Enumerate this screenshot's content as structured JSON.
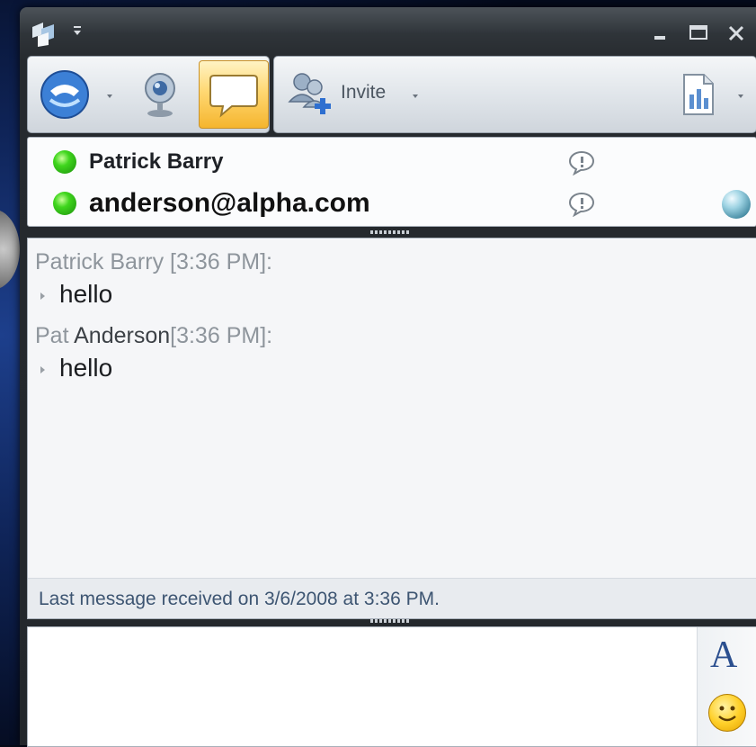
{
  "window": {
    "app_icon": "communicator-icon",
    "controls": [
      "minimize-icon",
      "maximize-icon",
      "close-icon"
    ]
  },
  "toolbar": {
    "call_icon": "phone-call-icon",
    "video_icon": "webcam-icon",
    "im_icon": "chat-bubble-icon",
    "invite_icon": "invite-people-icon",
    "invite_label": "Invite",
    "share_icon": "share-document-icon"
  },
  "participants": [
    {
      "name": "Patrick Barry",
      "status_color": "#3fd61d"
    },
    {
      "name": "anderson@alpha.com",
      "status_color": "#3fd61d"
    }
  ],
  "transcript": {
    "messages": [
      {
        "sender": "Patrick Barry",
        "sender_dark": "",
        "time": "[3:36 PM]:",
        "text": "hello"
      },
      {
        "sender": "Pat",
        "sender_dark": "Anderson",
        "time": "[3:36 PM]:",
        "text": "hello"
      }
    ],
    "status": "Last message received on 3/6/2008 at 3:36 PM."
  },
  "compose": {
    "value": "",
    "font_icon": "A",
    "emoticon_icon": "smiley-icon"
  },
  "colors": {
    "accent_active": "#ffd873",
    "presence_online": "#3fd61d",
    "status_text": "#3d5572"
  }
}
